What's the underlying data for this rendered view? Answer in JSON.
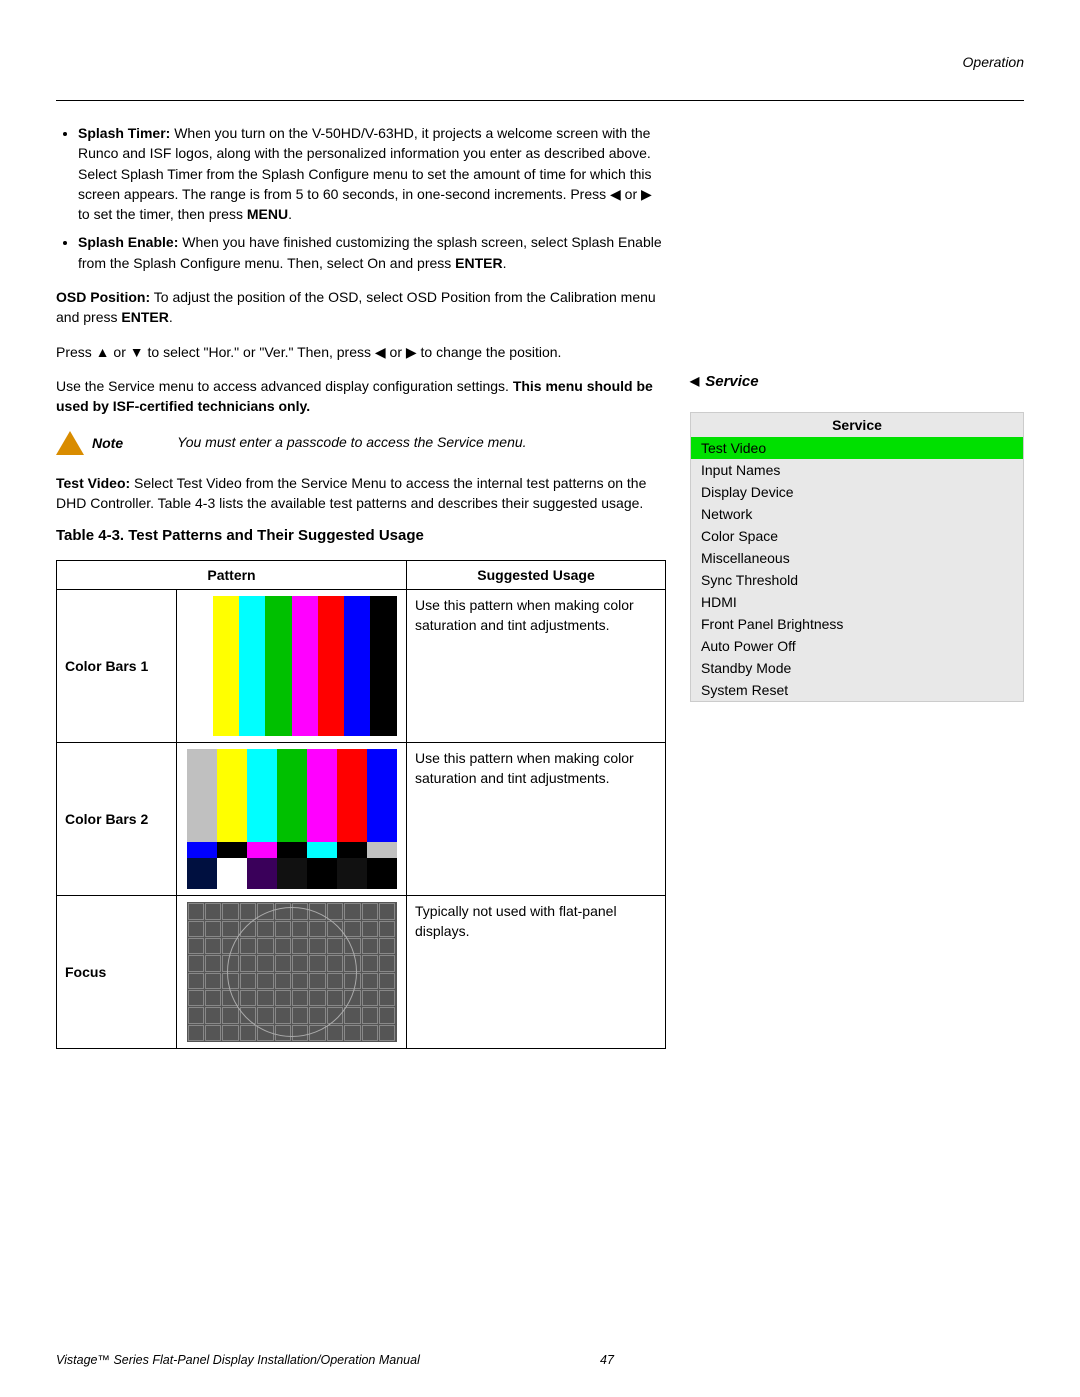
{
  "header": {
    "section": "Operation"
  },
  "bullets": [
    {
      "label": "Splash Timer:",
      "text": " When you turn on the V-50HD/V-63HD, it projects a welcome screen with the Runco and ISF logos, along with the personalized information you enter as described above. Select Splash Timer from the Splash Configure menu to set the amount of time for which this screen appears. The range is from 5 to 60 seconds, in one-second increments. Press ◀ or ▶ to set the timer, then press ",
      "tail_bold": "MENU",
      "tail": "."
    },
    {
      "label": "Splash Enable:",
      "text": " When you have finished customizing the splash screen, select Splash Enable from the Splash Configure menu. Then, select On and press ",
      "tail_bold": "ENTER",
      "tail": "."
    }
  ],
  "osd": {
    "label": "OSD Position:",
    "text": " To adjust the position of the OSD, select OSD Position from the Calibration menu and press ",
    "tail_bold": "ENTER",
    "tail": "."
  },
  "press": "Press ▲ or ▼ to select \"Hor.\" or \"Ver.\" Then, press ◀ or ▶ to change the position.",
  "service_intro": {
    "pre": "Use the Service menu to access advanced display configuration settings. ",
    "bold": "This menu should be used by ISF-certified technicians only."
  },
  "note": {
    "label": "Note",
    "text": "You must enter a passcode to access the Service menu."
  },
  "testvideo": {
    "label": "Test Video:",
    "text": " Select Test Video from the Service Menu to access the internal test patterns on the DHD Controller. Table 4-3 lists the available test patterns and describes their suggested usage."
  },
  "table_caption": "Table 4-3. Test Patterns and Their Suggested Usage",
  "table": {
    "col1": "Pattern",
    "col2": "Suggested Usage",
    "rows": [
      {
        "name": "Color Bars 1",
        "usage": "Use this pattern when making color saturation and tint adjustments."
      },
      {
        "name": "Color Bars 2",
        "usage": "Use this pattern when making color saturation and tint adjustments."
      },
      {
        "name": "Focus",
        "usage": "Typically not used with flat-panel displays."
      }
    ]
  },
  "service": {
    "heading": "Service",
    "title": "Service",
    "items": [
      {
        "label": "Test Video",
        "highlight": true
      },
      {
        "label": "Input Names"
      },
      {
        "label": "Display Device"
      },
      {
        "label": "Network"
      },
      {
        "label": "Color Space"
      },
      {
        "label": "Miscellaneous"
      },
      {
        "label": "Sync Threshold"
      },
      {
        "label": "HDMI"
      },
      {
        "label": "Front Panel Brightness"
      },
      {
        "label": "Auto Power Off"
      },
      {
        "label": "Standby Mode"
      },
      {
        "label": "System Reset"
      }
    ]
  },
  "footer": {
    "title": "Vistage™ Series Flat-Panel Display Installation/Operation Manual",
    "page": "47"
  }
}
